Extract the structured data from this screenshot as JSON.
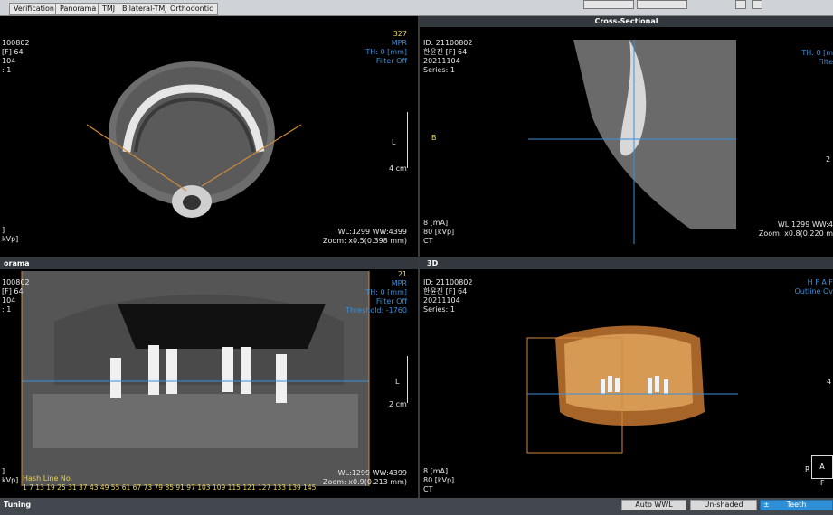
{
  "tabs": [
    "Verification",
    "Panorama",
    "TMJ",
    "Bilateral-TMJ",
    "Orthodontic"
  ],
  "axial": {
    "left_info": [
      "100802",
      "[F] 64",
      "104",
      ": 1"
    ],
    "top_right": [
      "327",
      "MPR",
      "TH: 0 [mm]",
      "Filter Off"
    ],
    "bottom_left": [
      "]",
      "kVp]"
    ],
    "bottom_right": [
      "WL:1299 WW:4399",
      "Zoom: x0.5(0.398 mm)"
    ],
    "ruler_label": "L",
    "scale": "4 cm"
  },
  "cross": {
    "title": "Cross-Sectional",
    "left_info": [
      "ID: 21100802",
      "한윤진 [F] 64",
      "20211104",
      "Series: 1"
    ],
    "marker": "B",
    "top_right": [
      "TH: 0 [m",
      "Filte"
    ],
    "right_mid": "2",
    "bottom_left": [
      "8 [mA]",
      "80 [kVp]",
      "CT"
    ],
    "bottom_right": [
      "WL:1299 WW:4",
      "Zoom: x0.8(0.220 m"
    ]
  },
  "panorama": {
    "title": "orama",
    "left_info": [
      "100802",
      "[F] 64",
      "104",
      ": 1"
    ],
    "top_right": [
      "21",
      "MPR",
      "TH: 0 [mm]",
      "Filter Off",
      "Threshold: -1760"
    ],
    "ruler_label": "L",
    "scale": "2 cm",
    "bottom_left": [
      "]",
      "kVp]"
    ],
    "hash_label": "Hash Line No.",
    "hash_numbers": "1   7   13  19  25  31  37  43  49  55  61  67  73  79  85  91  97 103 109 115 121 127 133 139 145",
    "bottom_right": [
      "WL:1299 WW:4399",
      "Zoom: x0.9(0.213 mm)"
    ]
  },
  "three_d": {
    "title": "3D",
    "left_info": [
      "ID: 21100802",
      "한윤진 [F] 64",
      "20211104",
      "Series: 1"
    ],
    "top_right": [
      "H F A F",
      "Outline Ov"
    ],
    "right_mid": "4",
    "bottom_left": [
      "8 [mA]",
      "80 [kVp]",
      "CT"
    ],
    "orient_r": "R",
    "orient_a": "A",
    "orient_f": "F"
  },
  "status": {
    "label": "Tuning",
    "buttons": [
      "Auto WWL",
      "Un-shaded",
      "Teeth"
    ],
    "teeth_prefix": "±"
  }
}
